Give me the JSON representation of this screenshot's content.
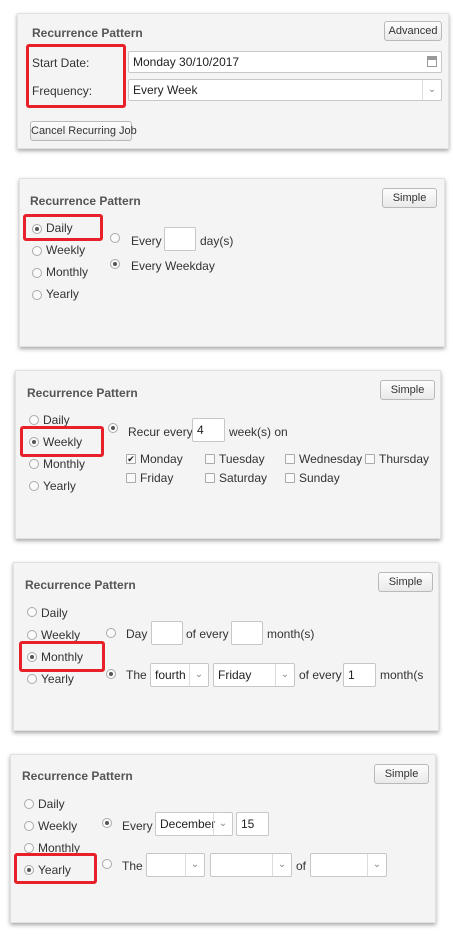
{
  "panel1": {
    "title": "Recurrence Pattern",
    "advanced_button": "Advanced",
    "start_date_label": "Start Date:",
    "start_date_value": "Monday 30/10/2017",
    "frequency_label": "Frequency:",
    "frequency_value": "Every Week",
    "cancel_button": "Cancel Recurring Job"
  },
  "panel2": {
    "title": "Recurrence Pattern",
    "simple_button": "Simple",
    "options": [
      "Daily",
      "Weekly",
      "Monthly",
      "Yearly"
    ],
    "selected": "Daily",
    "every_label": "Every",
    "days_value": "",
    "days_suffix": "day(s)",
    "every_weekday_label": "Every Weekday"
  },
  "panel3": {
    "title": "Recurrence Pattern",
    "simple_button": "Simple",
    "options": [
      "Daily",
      "Weekly",
      "Monthly",
      "Yearly"
    ],
    "selected": "Weekly",
    "recur_every_label": "Recur every",
    "weeks_value": "4",
    "weeks_suffix": "week(s) on",
    "days": [
      {
        "label": "Monday",
        "checked": true
      },
      {
        "label": "Tuesday",
        "checked": false
      },
      {
        "label": "Wednesday",
        "checked": false
      },
      {
        "label": "Thursday",
        "checked": false
      },
      {
        "label": "Friday",
        "checked": false
      },
      {
        "label": "Saturday",
        "checked": false
      },
      {
        "label": "Sunday",
        "checked": false
      }
    ]
  },
  "panel4": {
    "title": "Recurrence Pattern",
    "simple_button": "Simple",
    "options": [
      "Daily",
      "Weekly",
      "Monthly",
      "Yearly"
    ],
    "selected": "Monthly",
    "day_label": "Day",
    "day_value": "",
    "of_every_label": "of every",
    "months_value": "",
    "months_suffix": "month(s)",
    "the_label": "The",
    "ordinal_value": "fourth",
    "weekday_value": "Friday",
    "of_every_label_2": "of every",
    "months_value_2": "1",
    "months_suffix_2": "month(s"
  },
  "panel5": {
    "title": "Recurrence Pattern",
    "simple_button": "Simple",
    "options": [
      "Daily",
      "Weekly",
      "Monthly",
      "Yearly"
    ],
    "selected": "Yearly",
    "every_label": "Every",
    "month_value": "December",
    "day_value": "15",
    "the_label": "The",
    "ordinal_value": "",
    "weekday_value": "",
    "of_label": "of",
    "month2_value": ""
  },
  "colors": {
    "highlight": "#e8202a",
    "panel_bg": "#f4f4f4"
  }
}
